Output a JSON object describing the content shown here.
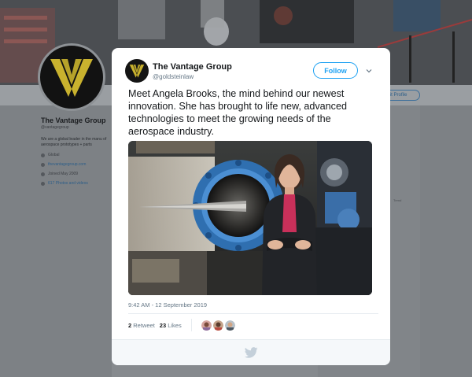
{
  "background": {
    "profile_name": "The Vantage Group",
    "profile_handle": "@vantagegroup",
    "bio": "We are a global leader in the manu of aerospace prototypes + parts",
    "location": "Global",
    "website": "thevantagegroup.com",
    "joined": "Joined May 2009",
    "photos": "617 Photos and videos",
    "edit_profile_label": "Edit Profile",
    "side_tag": "Trend"
  },
  "tweet": {
    "author_name": "The Vantage Group",
    "author_handle": "@goldsteinlaw",
    "follow_label": "Follow",
    "text": "Meet Angela Brooks, the mind behind our newest innovation. She has brought to life new, advanced technologies to meet the growing needs of the aerospace industry.",
    "timestamp": "9:42 AM - 12 September 2019",
    "retweet_count": "2",
    "retweet_label": "Retweet",
    "like_count": "23",
    "like_label": "Likes"
  },
  "colors": {
    "accent": "#1da1f2",
    "logo_gold": "#c9b22e"
  },
  "icons": {
    "caret": "chevron-down-icon",
    "footer": "bird-logo-icon"
  }
}
